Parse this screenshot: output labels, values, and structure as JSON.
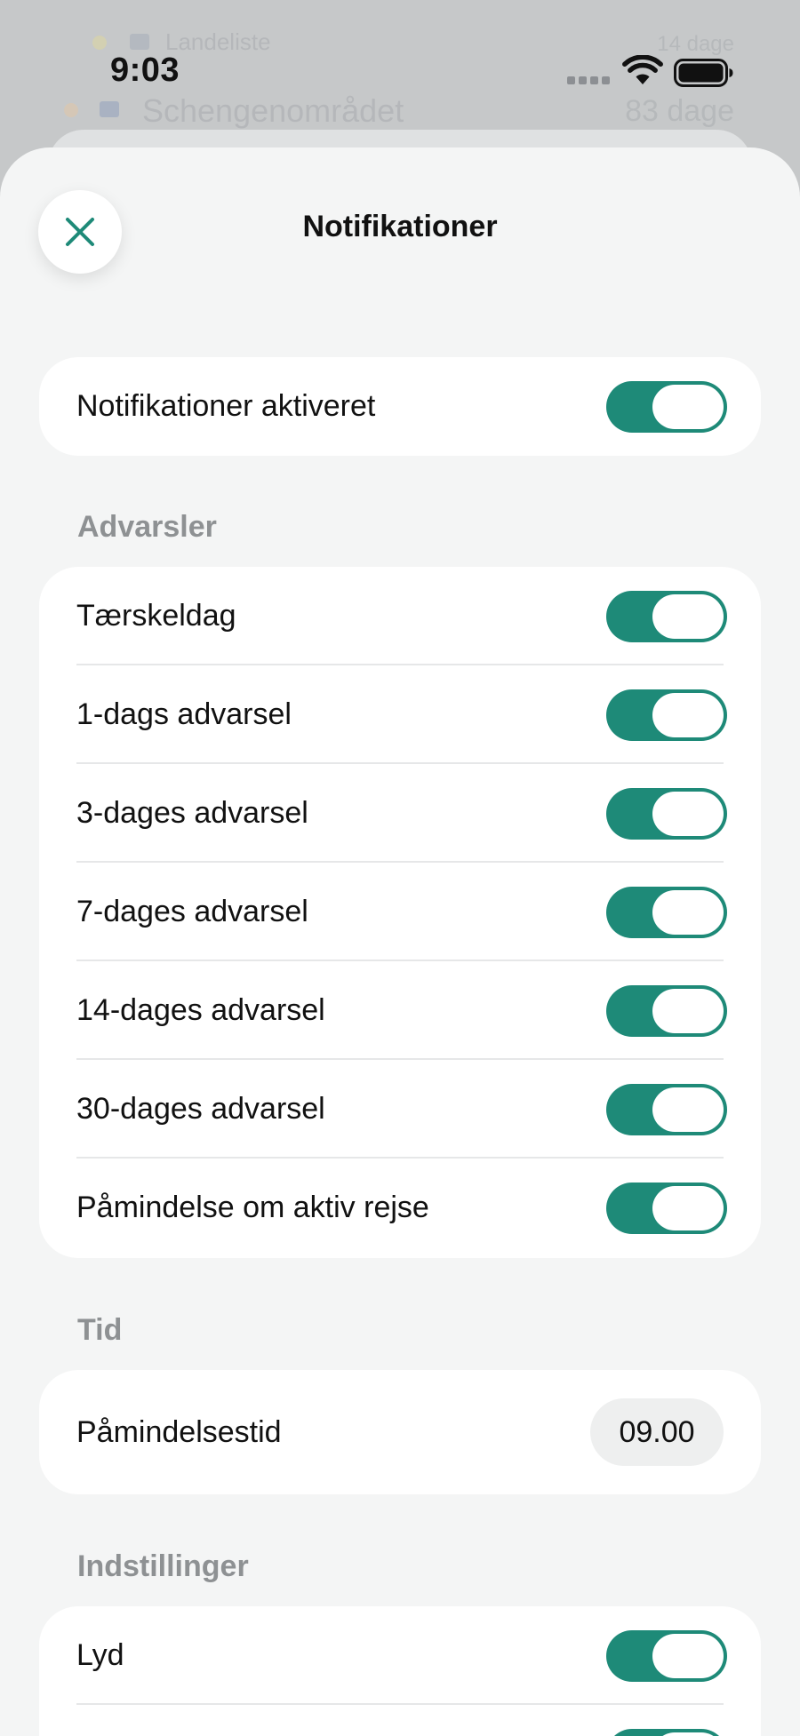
{
  "background": {
    "row1_left": "Landeliste",
    "row1_right": "14 dage",
    "row2_left": "Schengenområdet",
    "row2_right": "83 dage"
  },
  "status_bar": {
    "time": "9:03"
  },
  "sheet": {
    "title": "Notifikationer",
    "close_icon": "close-icon"
  },
  "master": {
    "label": "Notifikationer aktiveret",
    "enabled": true
  },
  "alerts": {
    "header": "Advarsler",
    "items": [
      {
        "label": "Tærskeldag",
        "enabled": true
      },
      {
        "label": "1-dags advarsel",
        "enabled": true
      },
      {
        "label": "3-dages advarsel",
        "enabled": true
      },
      {
        "label": "7-dages advarsel",
        "enabled": true
      },
      {
        "label": "14-dages advarsel",
        "enabled": true
      },
      {
        "label": "30-dages advarsel",
        "enabled": true
      },
      {
        "label": "Påmindelse om aktiv rejse",
        "enabled": true
      }
    ]
  },
  "time": {
    "header": "Tid",
    "reminder_label": "Påmindelsestid",
    "reminder_value": "09.00"
  },
  "settings": {
    "header": "Indstillinger",
    "items": [
      {
        "label": "Lyd",
        "enabled": true
      }
    ]
  },
  "colors": {
    "accent": "#1e8a78",
    "sheet_background": "#f4f5f5",
    "card_background": "#ffffff",
    "section_header": "#8e9193"
  }
}
